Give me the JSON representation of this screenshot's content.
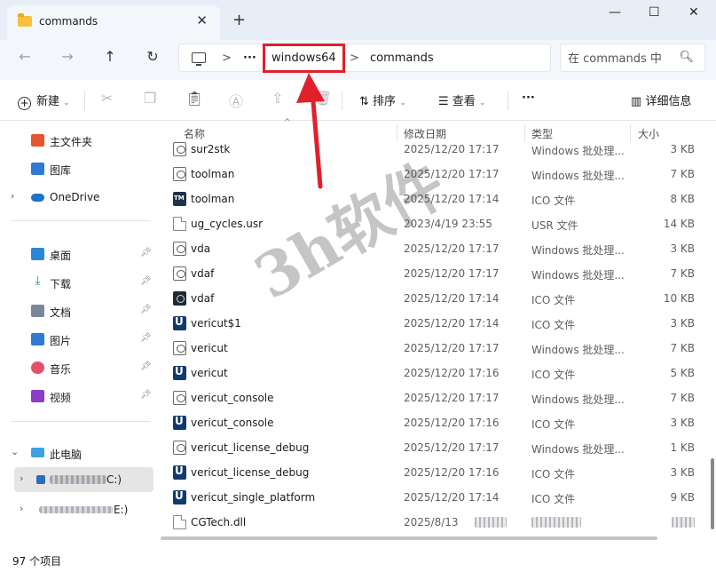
{
  "window": {
    "tab_title": "commands",
    "tab_close": "✕",
    "new_tab": "+",
    "minimize": "—",
    "maximize": "☐",
    "close": "✕"
  },
  "nav": {
    "back_icon": "back-arrow-icon",
    "forward_icon": "forward-arrow-icon",
    "up_icon": "up-arrow-icon",
    "refresh_icon": "refresh-icon",
    "ellipsis": "···",
    "separator": ">",
    "breadcrumbs": [
      "windows64",
      "commands"
    ],
    "search_placeholder": "在 commands 中"
  },
  "toolbar": {
    "new_label": "新建",
    "sort_label": "排序",
    "view_label": "查看",
    "more_label": "···",
    "details_label": "详细信息"
  },
  "sidebar": {
    "quick": [
      {
        "label": "主文件夹",
        "icon": "home-icon",
        "color": "#e4572e"
      },
      {
        "label": "图库",
        "icon": "gallery-icon",
        "color": "#2f7bd3"
      },
      {
        "label": "OneDrive",
        "icon": "cloud-icon",
        "color": "#1e72c8"
      }
    ],
    "pinned": [
      {
        "label": "桌面",
        "icon": "desktop-icon",
        "color": "#2b88d8"
      },
      {
        "label": "下载",
        "icon": "download-icon",
        "color": "#1e9e6f"
      },
      {
        "label": "文档",
        "icon": "document-icon",
        "color": "#7a869a"
      },
      {
        "label": "图片",
        "icon": "pictures-icon",
        "color": "#2f7bd3"
      },
      {
        "label": "音乐",
        "icon": "music-icon",
        "color": "#e2506d"
      },
      {
        "label": "视频",
        "icon": "video-icon",
        "color": "#8a3ec9"
      }
    ],
    "this_pc": "此电脑",
    "drives": [
      "C:)",
      "E:)"
    ]
  },
  "columns": {
    "name": "名称",
    "date": "修改日期",
    "type": "类型",
    "size": "大小"
  },
  "files": [
    {
      "name": "sur2stk",
      "date": "2025/12/20 17:17",
      "type": "Windows 批处理...",
      "size": "3 KB",
      "icon": "bat"
    },
    {
      "name": "toolman",
      "date": "2025/12/20 17:17",
      "type": "Windows 批处理...",
      "size": "7 KB",
      "icon": "bat"
    },
    {
      "name": "toolman",
      "date": "2025/12/20 17:14",
      "type": "ICO 文件",
      "size": "8 KB",
      "icon": "tm"
    },
    {
      "name": "ug_cycles.usr",
      "date": "2023/4/19 23:55",
      "type": "USR 文件",
      "size": "14 KB",
      "icon": "usr"
    },
    {
      "name": "vda",
      "date": "2025/12/20 17:17",
      "type": "Windows 批处理...",
      "size": "3 KB",
      "icon": "bat"
    },
    {
      "name": "vdaf",
      "date": "2025/12/20 17:17",
      "type": "Windows 批处理...",
      "size": "7 KB",
      "icon": "bat"
    },
    {
      "name": "vdaf",
      "date": "2025/12/20 17:14",
      "type": "ICO 文件",
      "size": "10 KB",
      "icon": "vdaf"
    },
    {
      "name": "vericut$1",
      "date": "2025/12/20 17:14",
      "type": "ICO 文件",
      "size": "3 KB",
      "icon": "vericut"
    },
    {
      "name": "vericut",
      "date": "2025/12/20 17:17",
      "type": "Windows 批处理...",
      "size": "7 KB",
      "icon": "bat"
    },
    {
      "name": "vericut",
      "date": "2025/12/20 17:16",
      "type": "ICO 文件",
      "size": "5 KB",
      "icon": "vericut"
    },
    {
      "name": "vericut_console",
      "date": "2025/12/20 17:17",
      "type": "Windows 批处理...",
      "size": "7 KB",
      "icon": "bat"
    },
    {
      "name": "vericut_console",
      "date": "2025/12/20 17:16",
      "type": "ICO 文件",
      "size": "3 KB",
      "icon": "vericut"
    },
    {
      "name": "vericut_license_debug",
      "date": "2025/12/20 17:17",
      "type": "Windows 批处理...",
      "size": "1 KB",
      "icon": "bat"
    },
    {
      "name": "vericut_license_debug",
      "date": "2025/12/20 17:16",
      "type": "ICO 文件",
      "size": "3 KB",
      "icon": "vericut"
    },
    {
      "name": "vericut_single_platform",
      "date": "2025/12/20 17:14",
      "type": "ICO 文件",
      "size": "9 KB",
      "icon": "vericut"
    },
    {
      "name": "CGTech.dll",
      "date": "2025/8/13",
      "type": "",
      "size": "",
      "icon": "dll"
    }
  ],
  "status": {
    "count": "97 个项目"
  },
  "watermark": "3h软件",
  "annotation_color": "#e0202a"
}
